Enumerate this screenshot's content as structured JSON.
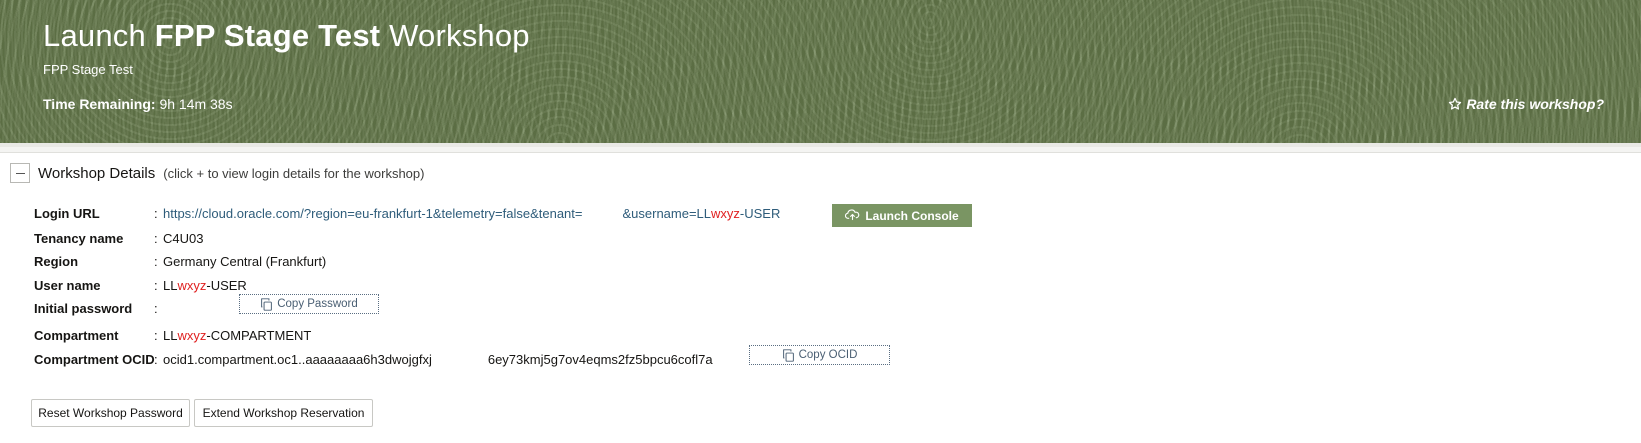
{
  "hero": {
    "title_prefix": "Launch ",
    "title_bold": "FPP Stage Test",
    "title_suffix": " Workshop",
    "subtitle": "FPP Stage Test",
    "time_label": "Time Remaining:",
    "time_value": "9h 14m 38s",
    "rate_label": "Rate this workshop?",
    "rate_icon": "star-outline-icon"
  },
  "details": {
    "toggle_icon": "minus-icon",
    "title": "Workshop Details",
    "hint": "(click + to view login details for the workshop)",
    "login_url": {
      "label": "Login URL",
      "colon": ":",
      "url_part1": "https://cloud.oracle.com/?region=eu-frankfurt-1&telemetry=false&tenant=",
      "url_part2": "&username=LL",
      "url_red": "wxyz",
      "url_part3": "-USER"
    },
    "launch_button": {
      "label": "Launch Console",
      "icon": "cloud-icon"
    },
    "tenancy": {
      "label": "Tenancy name",
      "colon": ":",
      "value": "C4U03"
    },
    "region": {
      "label": "Region",
      "colon": ":",
      "value": "Germany Central (Frankfurt)"
    },
    "user": {
      "label": "User name",
      "colon": ":",
      "prefix": "LL",
      "red": "wxyz",
      "suffix": "-USER"
    },
    "password": {
      "label": "Initial password",
      "colon": ":",
      "copy_label": "Copy Password",
      "copy_icon": "copy-icon"
    },
    "compartment": {
      "label": "Compartment",
      "colon": ":",
      "prefix": "LL",
      "red": "wxyz",
      "suffix": "-COMPARTMENT"
    },
    "compartment_ocid": {
      "label": "Compartment OCID",
      "colon": ":",
      "value_part1": "ocid1.compartment.oc1..aaaaaaaa6h3dwojgfxj",
      "value_part2": "6ey73kmj5g7ov4eqms2fz5bpcu6cofl7a",
      "copy_label": "Copy OCID",
      "copy_icon": "copy-icon"
    }
  },
  "actions": {
    "reset_label": "Reset Workshop Password",
    "extend_label": "Extend Workshop Reservation"
  },
  "colors": {
    "hero_green": "#6a7f4f",
    "launch_green": "#7a9563",
    "highlight_red": "#e02020",
    "link_blue": "#2e5c7a"
  }
}
